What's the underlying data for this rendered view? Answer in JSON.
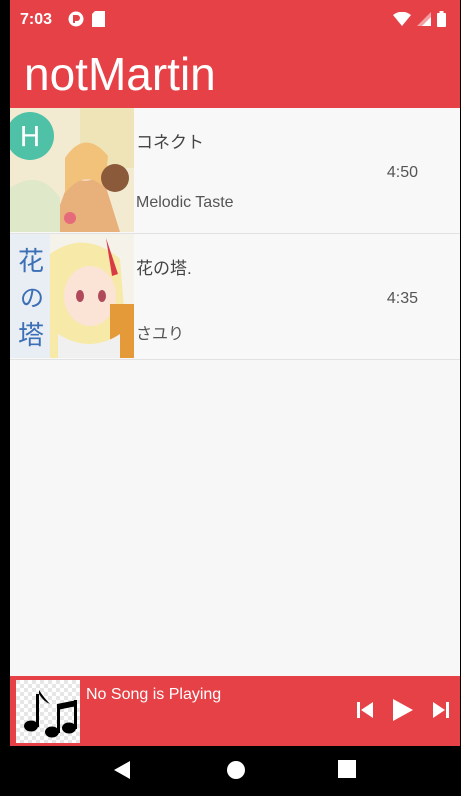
{
  "status_bar": {
    "time": "7:03",
    "left_icons": [
      "pocket-casts-icon",
      "sd-card-icon"
    ],
    "right_icons": [
      "wifi-icon",
      "signal-icon",
      "battery-icon"
    ]
  },
  "app_bar": {
    "title": "notMartin",
    "color": "#e64146"
  },
  "songs": [
    {
      "title": "コネクト",
      "artist": "Melodic Taste",
      "duration": "4:50",
      "cover": "album-cover-connect"
    },
    {
      "title": "花の塔.",
      "artist": "さユり",
      "duration": "4:35",
      "cover": "album-cover-hana-no-tou"
    }
  ],
  "player": {
    "status": "No Song is Playing",
    "art_icon": "music-notes-icon",
    "controls": [
      "skip-previous-icon",
      "play-icon",
      "skip-next-icon"
    ]
  },
  "nav_bar": {
    "buttons": [
      "back-icon",
      "home-icon",
      "recents-icon"
    ]
  }
}
